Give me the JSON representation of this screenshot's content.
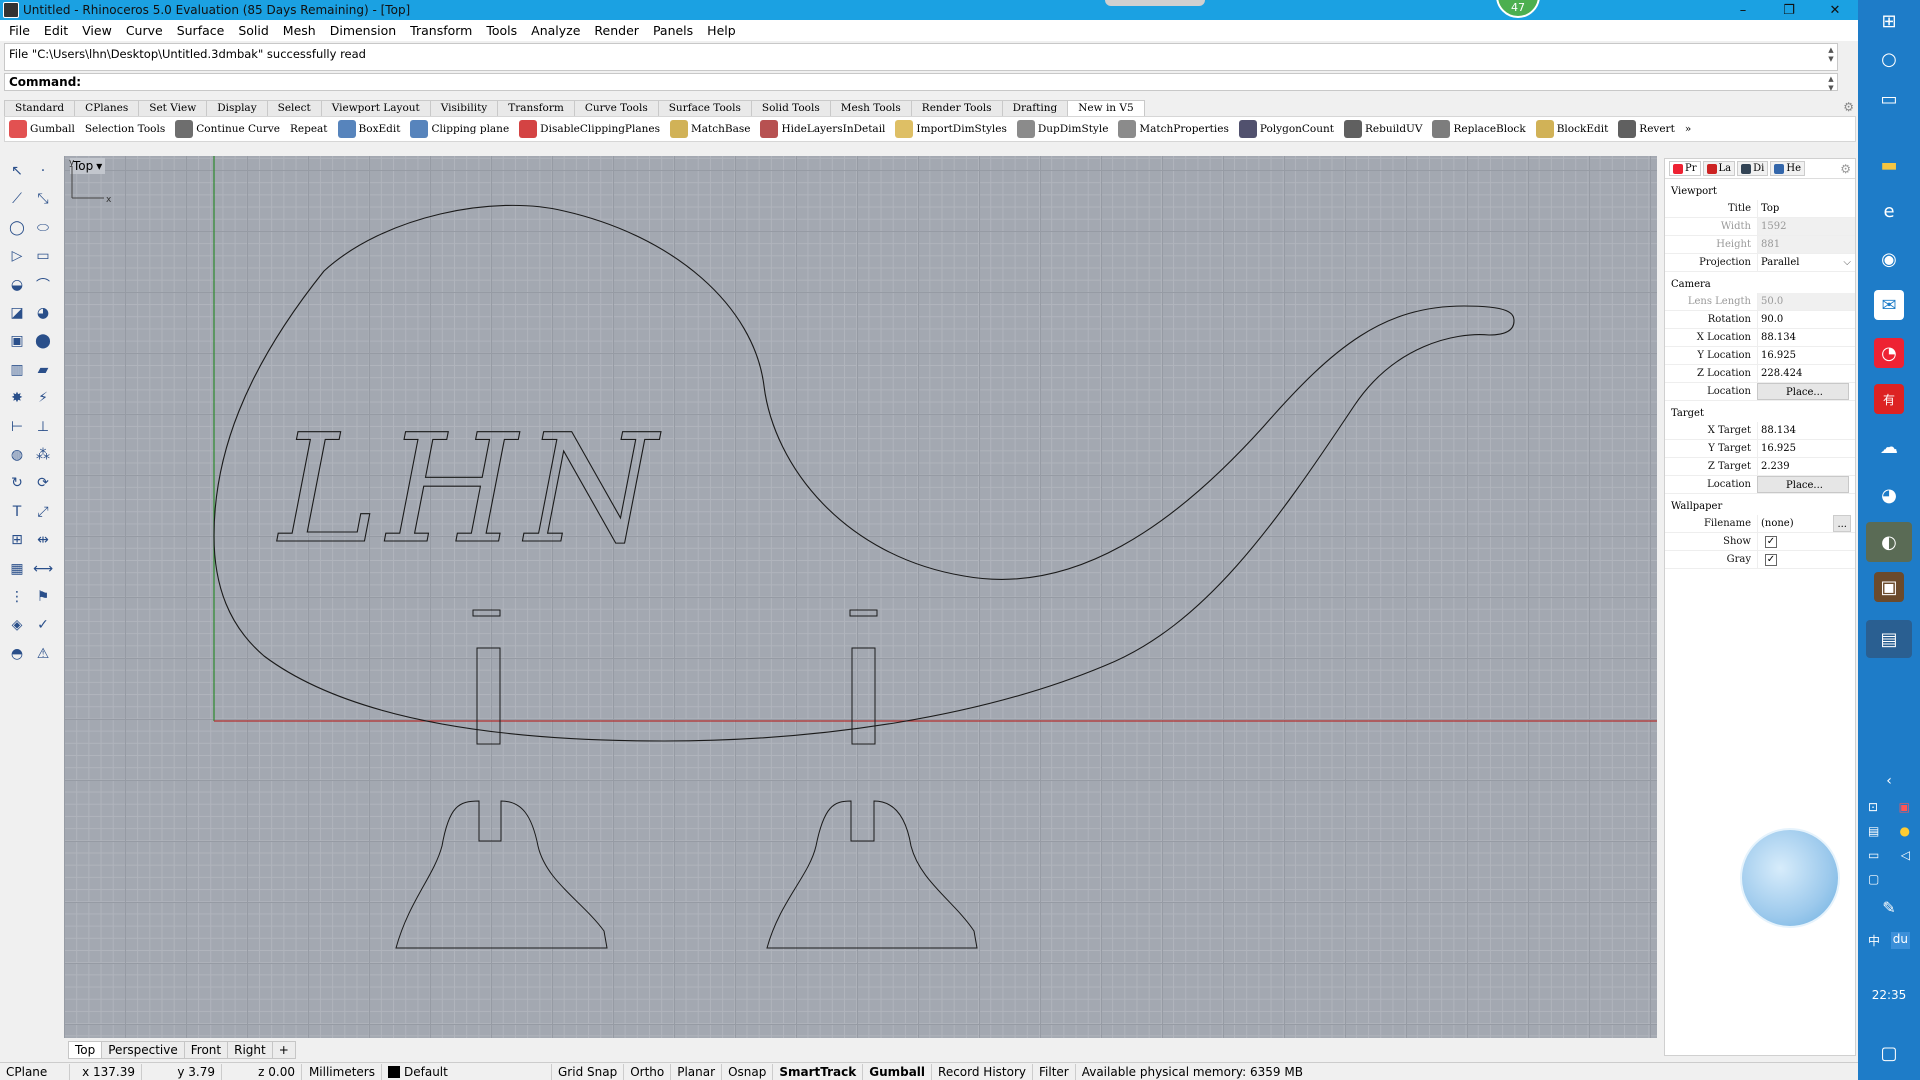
{
  "window": {
    "title": "Untitled - Rhinoceros 5.0 Evaluation (85 Days Remaining) - [Top]",
    "badge": "47",
    "minimize": "–",
    "maximize": "❐",
    "close": "✕"
  },
  "menu": [
    "File",
    "Edit",
    "View",
    "Curve",
    "Surface",
    "Solid",
    "Mesh",
    "Dimension",
    "Transform",
    "Tools",
    "Analyze",
    "Render",
    "Panels",
    "Help"
  ],
  "command": {
    "history": "File \"C:\\Users\\lhn\\Desktop\\Untitled.3dmbak\" successfully read",
    "prompt": "Command:"
  },
  "toolbar_tabs": [
    "Standard",
    "CPlanes",
    "Set View",
    "Display",
    "Select",
    "Viewport Layout",
    "Visibility",
    "Transform",
    "Curve Tools",
    "Surface Tools",
    "Solid Tools",
    "Mesh Tools",
    "Render Tools",
    "Drafting",
    "New in V5"
  ],
  "active_toolbar_tab": "New in V5",
  "toolbar_commands": [
    {
      "label": "Gumball",
      "icon": "gumball-icon",
      "color": "#d33"
    },
    {
      "label": "Selection Tools",
      "icon": "",
      "color": ""
    },
    {
      "label": "Continue Curve",
      "icon": "continue-curve-icon",
      "color": "#555"
    },
    {
      "label": "Repeat",
      "icon": "",
      "color": ""
    },
    {
      "label": "BoxEdit",
      "icon": "boxedit-icon",
      "color": "#3a6fb0"
    },
    {
      "label": "Clipping plane",
      "icon": "clipping-plane-icon",
      "color": "#3a6fb0"
    },
    {
      "label": "DisableClippingPlanes",
      "icon": "disable-clipping-icon",
      "color": "#c22"
    },
    {
      "label": "MatchBase",
      "icon": "matchbase-icon",
      "color": "#c9a43a"
    },
    {
      "label": "HideLayersInDetail",
      "icon": "hide-layers-icon",
      "color": "#a33"
    },
    {
      "label": "ImportDimStyles",
      "icon": "import-dimstyles-icon",
      "color": "#d8b44a"
    },
    {
      "label": "DupDimStyle",
      "icon": "dupdimstyle-icon",
      "color": "#777"
    },
    {
      "label": "MatchProperties",
      "icon": "matchproperties-icon",
      "color": "#777"
    },
    {
      "label": "PolygonCount",
      "icon": "polygoncount-icon",
      "color": "#335"
    },
    {
      "label": "RebuildUV",
      "icon": "rebuilduv-icon",
      "color": "#444"
    },
    {
      "label": "ReplaceBlock",
      "icon": "replaceblock-icon",
      "color": "#666"
    },
    {
      "label": "BlockEdit",
      "icon": "blockedit-icon",
      "color": "#c9a43a"
    },
    {
      "label": "Revert",
      "icon": "revert-icon",
      "color": "#444"
    },
    {
      "label": "»",
      "icon": "",
      "color": ""
    }
  ],
  "viewport": {
    "name": "Top",
    "dropdown": "▾",
    "axis_y": "y",
    "axis_x": "x",
    "text_art": "LHN"
  },
  "viewport_tabs": [
    "Top",
    "Perspective",
    "Front",
    "Right",
    "+"
  ],
  "active_viewport_tab": "Top",
  "properties": {
    "tabs": [
      {
        "label": "Pr",
        "color": "#e23"
      },
      {
        "label": "La",
        "color": "#c22"
      },
      {
        "label": "Di",
        "color": "#345"
      },
      {
        "label": "He",
        "color": "#36a"
      }
    ],
    "viewport_section": "Viewport",
    "viewport_rows": [
      {
        "key": "Title",
        "value": "Top",
        "dim": false
      },
      {
        "key": "Width",
        "value": "1592",
        "dim": true
      },
      {
        "key": "Height",
        "value": "881",
        "dim": true
      },
      {
        "key": "Projection",
        "value": "Parallel",
        "dim": false,
        "select": true
      }
    ],
    "camera_section": "Camera",
    "camera_rows": [
      {
        "key": "Lens Length",
        "value": "50.0",
        "dim": true
      },
      {
        "key": "Rotation",
        "value": "90.0",
        "dim": false
      },
      {
        "key": "X Location",
        "value": "88.134",
        "dim": false
      },
      {
        "key": "Y Location",
        "value": "16.925",
        "dim": false
      },
      {
        "key": "Z Location",
        "value": "228.424",
        "dim": false
      },
      {
        "key": "Location",
        "value": "Place...",
        "button": true
      }
    ],
    "target_section": "Target",
    "target_rows": [
      {
        "key": "X Target",
        "value": "88.134",
        "dim": false
      },
      {
        "key": "Y Target",
        "value": "16.925",
        "dim": false
      },
      {
        "key": "Z Target",
        "value": "2.239",
        "dim": false
      },
      {
        "key": "Location",
        "value": "Place...",
        "button": true
      }
    ],
    "wallpaper_section": "Wallpaper",
    "wallpaper_filename_key": "Filename",
    "wallpaper_filename": "(none)",
    "wallpaper_browse": "...",
    "wallpaper_show_key": "Show",
    "wallpaper_show": true,
    "wallpaper_gray_key": "Gray",
    "wallpaper_gray": true
  },
  "status": {
    "cplane": "CPlane",
    "x": "x 137.39",
    "y": "y 3.79",
    "z": "z 0.00",
    "units": "Millimeters",
    "layer": "Default",
    "grid_snap": "Grid Snap",
    "ortho": "Ortho",
    "planar": "Planar",
    "osnap": "Osnap",
    "smarttrack": "SmartTrack",
    "gumball": "Gumball",
    "record_history": "Record History",
    "filter": "Filter",
    "memory": "Available physical memory: 6359 MB"
  },
  "taskbar": {
    "clock": "22:35",
    "ime": "中",
    "du": "du",
    "accent": "#1e7cc8"
  }
}
